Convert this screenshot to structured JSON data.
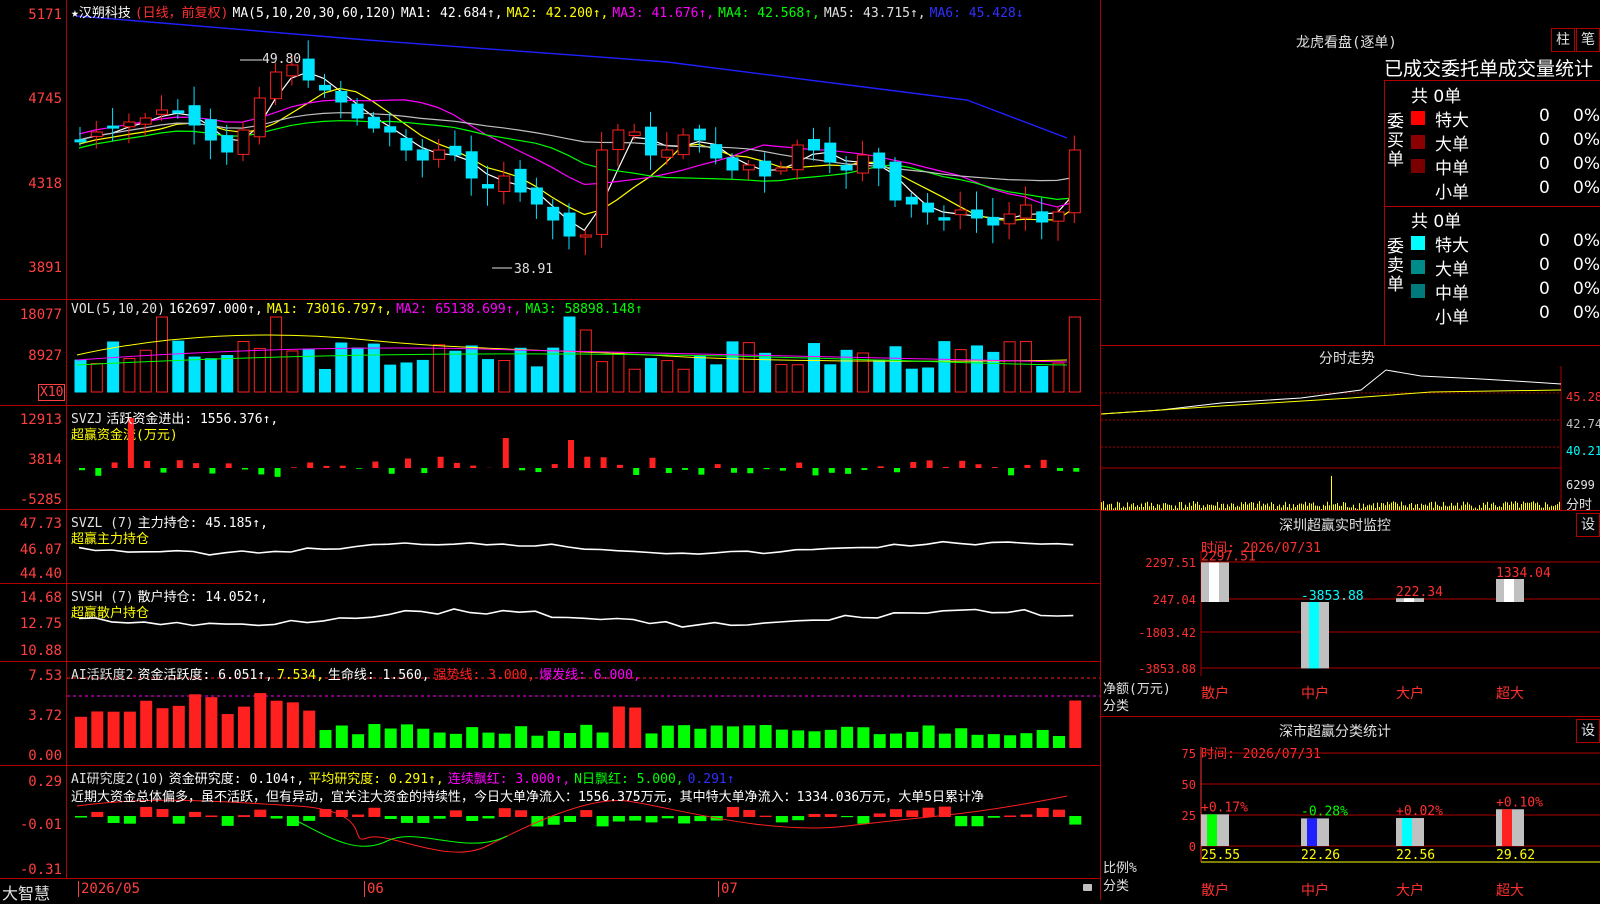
{
  "colors": {
    "up": "#ff2020",
    "down": "#00e5ff",
    "ma1": "#ffffff",
    "ma2": "#ffff00",
    "ma3": "#ff00ff",
    "ma4": "#00ff00",
    "ma5": "#c0c0c0",
    "ma6": "#2020ff",
    "grid": "#b00000",
    "axis": "#ff4040"
  },
  "price_pane": {
    "header": {
      "star": "★",
      "stock": "汉朔科技",
      "mode": "(日线，前复权)",
      "ma_label": "MA(5,10,20,30,60,120)",
      "ma1": "MA1: 42.684↑,",
      "ma2": "MA2: 42.200↑,",
      "ma3": "MA3: 41.676↑,",
      "ma4": "MA4: 42.568↑,",
      "ma5": "MA5: 43.715↑,",
      "ma6": "MA6: 45.428↓"
    },
    "y_ticks": [
      "5171",
      "4745",
      "4318",
      "3891"
    ],
    "high_label": "49.80",
    "low_label": "38.91"
  },
  "vol_pane": {
    "header": {
      "name": "VOL(5,10,20)",
      "value": "162697.000↑,",
      "ma1": "MA1: 73016.797↑,",
      "ma2": "MA2: 65138.699↑,",
      "ma3": "MA3: 58898.148↑"
    },
    "y_ticks": [
      "18077",
      "8927"
    ],
    "unit": "X10"
  },
  "svzj_pane": {
    "header": {
      "name": "SVZJ",
      "text": "活跃资金进出: 1556.376↑,"
    },
    "subtitle": "超赢资金流(万元)",
    "y_ticks": [
      "12913",
      "3814",
      "-5285"
    ]
  },
  "svzl_pane": {
    "header": {
      "name": "SVZL (7)",
      "text": "主力持仓: 45.185↑,"
    },
    "subtitle": "超赢主力持仓",
    "y_ticks": [
      "47.73",
      "46.07",
      "44.40"
    ]
  },
  "svsh_pane": {
    "header": {
      "name": "SVSH (7)",
      "text": "散户持仓: 14.052↑,"
    },
    "subtitle": "超赢散户持仓",
    "y_ticks": [
      "14.68",
      "12.75",
      "10.88"
    ]
  },
  "ai1_pane": {
    "header": {
      "name": "AI活跃度2",
      "t1": "资金活跃度: 6.051↑,",
      "t2": "7.534,",
      "t3": "生命线: 1.560,",
      "t4": "强势线: 3.000,",
      "t5": "爆发线: 6.000,"
    },
    "y_ticks": [
      "7.53",
      "3.72",
      "0.00"
    ]
  },
  "ai2_pane": {
    "header": {
      "name": "AI研究度2(10)",
      "t1": "资金研究度: 0.104↑,",
      "t2": "平均研究度: 0.291↑,",
      "t3": "连续飘红: 3.000↑,",
      "t4": "N日飘红: 5.000,",
      "t5": "0.291↑"
    },
    "comment": "近期大资金总体偏多，虽不活跃，但有异动，宜关注大资金的持续性，今日大单净流入：1556.375万元，其中特大单净流入：1334.036万元，大单5日累计净",
    "y_ticks": [
      "0.29",
      "-0.01",
      "-0.31"
    ]
  },
  "bottom_bar": {
    "brand": "大智慧",
    "dates": [
      "2026/05",
      "06",
      "07"
    ]
  },
  "dragon_panel": {
    "title": "龙虎看盘(逐单)",
    "btn1": "柱",
    "btn2": "笔",
    "tabs": "已成交委托单成交量统计",
    "buy": {
      "side": "委买单",
      "total": "共 0单",
      "rows": [
        {
          "label": "特大",
          "v": "0",
          "p": "0%",
          "c": "#ff0000"
        },
        {
          "label": "大单",
          "v": "0",
          "p": "0%",
          "c": "#8b0000"
        },
        {
          "label": "中单",
          "v": "0",
          "p": "0%",
          "c": "#7a0000"
        },
        {
          "label": "小单",
          "v": "0",
          "p": "0%",
          "c": "#000000"
        }
      ]
    },
    "sell": {
      "side": "委卖单",
      "total": "共 0单",
      "rows": [
        {
          "label": "特大",
          "v": "0",
          "p": "0%",
          "c": "#00ffff"
        },
        {
          "label": "大单",
          "v": "0",
          "p": "0%",
          "c": "#008b8b"
        },
        {
          "label": "中单",
          "v": "0",
          "p": "0%",
          "c": "#007a7a"
        },
        {
          "label": "小单",
          "v": "0",
          "p": "0%",
          "c": "#000000"
        }
      ]
    }
  },
  "intraday_panel": {
    "title": "分时走势",
    "y_ticks": [
      "45.28",
      "42.74",
      "40.21"
    ],
    "vol_label": "6299",
    "vol_unit": "分时"
  },
  "sz_monitor": {
    "title": "深圳超赢实时监控",
    "btn": "设",
    "time": "时间: 2026/07/31",
    "y_ticks": [
      "2297.51",
      "247.04",
      "-1803.42",
      "-3853.88"
    ],
    "y_label": "净额(万元)",
    "y_label2": "分类",
    "bars": [
      {
        "cat": "散户",
        "v": 2297.51,
        "label": "2297.51"
      },
      {
        "cat": "中户",
        "v": -3853.88,
        "label": "-3853.88"
      },
      {
        "cat": "大户",
        "v": 222.34,
        "label": "222.34"
      },
      {
        "cat": "超大",
        "v": 1334.04,
        "label": "1334.04"
      }
    ]
  },
  "sz_classify": {
    "title": "深市超赢分类统计",
    "btn": "设",
    "time": "时间: 2026/07/31",
    "y_ticks": [
      "75",
      "50",
      "25",
      "0"
    ],
    "y_label": "比例%",
    "y_label2": "分类",
    "bars": [
      {
        "cat": "散户",
        "v": 25.55,
        "label": "25.55",
        "chg": "+0.17%"
      },
      {
        "cat": "中户",
        "v": 22.26,
        "label": "22.26",
        "chg": "-0.28%"
      },
      {
        "cat": "大户",
        "v": 22.56,
        "label": "22.56",
        "chg": "+0.02%"
      },
      {
        "cat": "超大",
        "v": 29.62,
        "label": "29.62",
        "chg": "+0.10%"
      }
    ]
  }
}
